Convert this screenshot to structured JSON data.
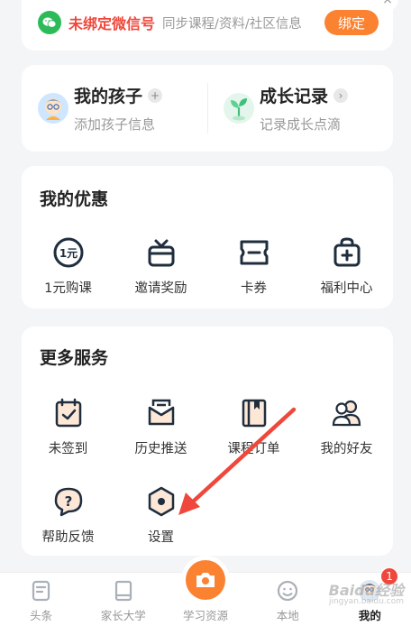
{
  "wechat_banner": {
    "title": "未绑定微信号",
    "description": "同步课程/资料/社区信息",
    "bind_label": "绑定",
    "close_glyph": "×"
  },
  "profile_row": {
    "kids": {
      "title": "我的孩子",
      "subtitle": "添加孩子信息",
      "badge": "+"
    },
    "growth": {
      "title": "成长记录",
      "subtitle": "记录成长点滴",
      "badge": "›"
    }
  },
  "offers": {
    "title": "我的优惠",
    "items": [
      {
        "label": "1元购课",
        "icon": "one-yuan-coin-icon",
        "glyph": "1元"
      },
      {
        "label": "邀请奖励",
        "icon": "gift-icon"
      },
      {
        "label": "卡券",
        "icon": "ticket-icon"
      },
      {
        "label": "福利中心",
        "icon": "welfare-bag-icon"
      }
    ]
  },
  "services": {
    "title": "更多服务",
    "items": [
      {
        "label": "未签到",
        "icon": "calendar-check-icon"
      },
      {
        "label": "历史推送",
        "icon": "envelope-icon"
      },
      {
        "label": "课程订单",
        "icon": "book-order-icon"
      },
      {
        "label": "我的好友",
        "icon": "friends-icon"
      },
      {
        "label": "帮助反馈",
        "icon": "help-bubble-icon",
        "glyph": "?"
      },
      {
        "label": "设置",
        "icon": "settings-hex-icon"
      }
    ]
  },
  "tabbar": {
    "items": [
      {
        "label": "头条",
        "icon": "headline-icon"
      },
      {
        "label": "家长大学",
        "icon": "book-icon"
      },
      {
        "label": "学习资源",
        "icon": "camera-icon"
      },
      {
        "label": "本地",
        "icon": "smile-icon"
      },
      {
        "label": "我的",
        "icon": "profile-avatar-icon",
        "badge": "1",
        "active": true
      }
    ]
  },
  "watermark": {
    "text": "Baidu经验",
    "sub": "jingyan.baidu.com"
  },
  "colors": {
    "accent": "#fb8231",
    "alert": "#f0473c",
    "wechat": "#2dbb5a",
    "icon_stroke": "#1f2d3d"
  }
}
